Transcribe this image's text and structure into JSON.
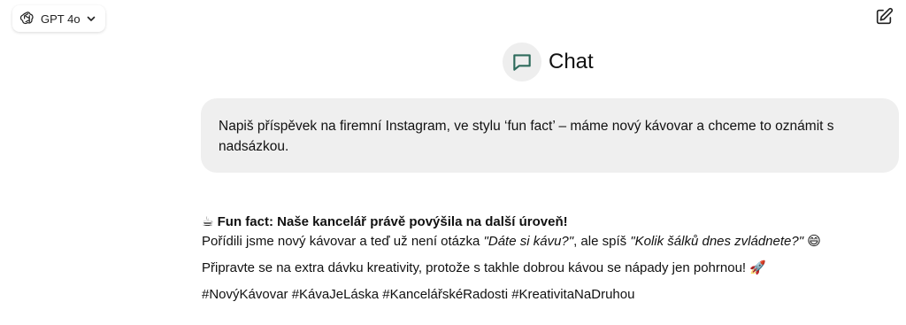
{
  "model_selector": {
    "label": "GPT 4o",
    "icon": "openai-logo-icon",
    "chevron": "chevron-down-icon"
  },
  "compose": {
    "icon": "new-chat-icon"
  },
  "header": {
    "title": "Chat",
    "icon": "chat-bubble-icon"
  },
  "user_message": {
    "text": "Napiš příspěvek na firemní Instagram, ve stylu ‘fun fact’ – máme nový kávovar a chceme to oznámit s nadsázkou."
  },
  "assistant_message": {
    "heading_emoji": "☕",
    "heading": "Fun fact: Naše kancelář právě povýšila na další úroveň!",
    "line1_a": "Pořídili jsme nový kávovar a teď už není otázka ",
    "line1_q1": "\"Dáte si kávu?\"",
    "line1_b": ", ale spíš ",
    "line1_q2": "\"Kolik šálků dnes zvládnete?\"",
    "line1_emoji": "😄",
    "paragraph2": "Připravte se na extra dávku kreativity, protože s takhle dobrou kávou se nápady jen pohrnou!",
    "paragraph2_emoji": "🚀",
    "hashtags": "#NovýKávovar #KávaJeLáska #KancelářskéRadosti #KreativitaNaDruhou"
  }
}
